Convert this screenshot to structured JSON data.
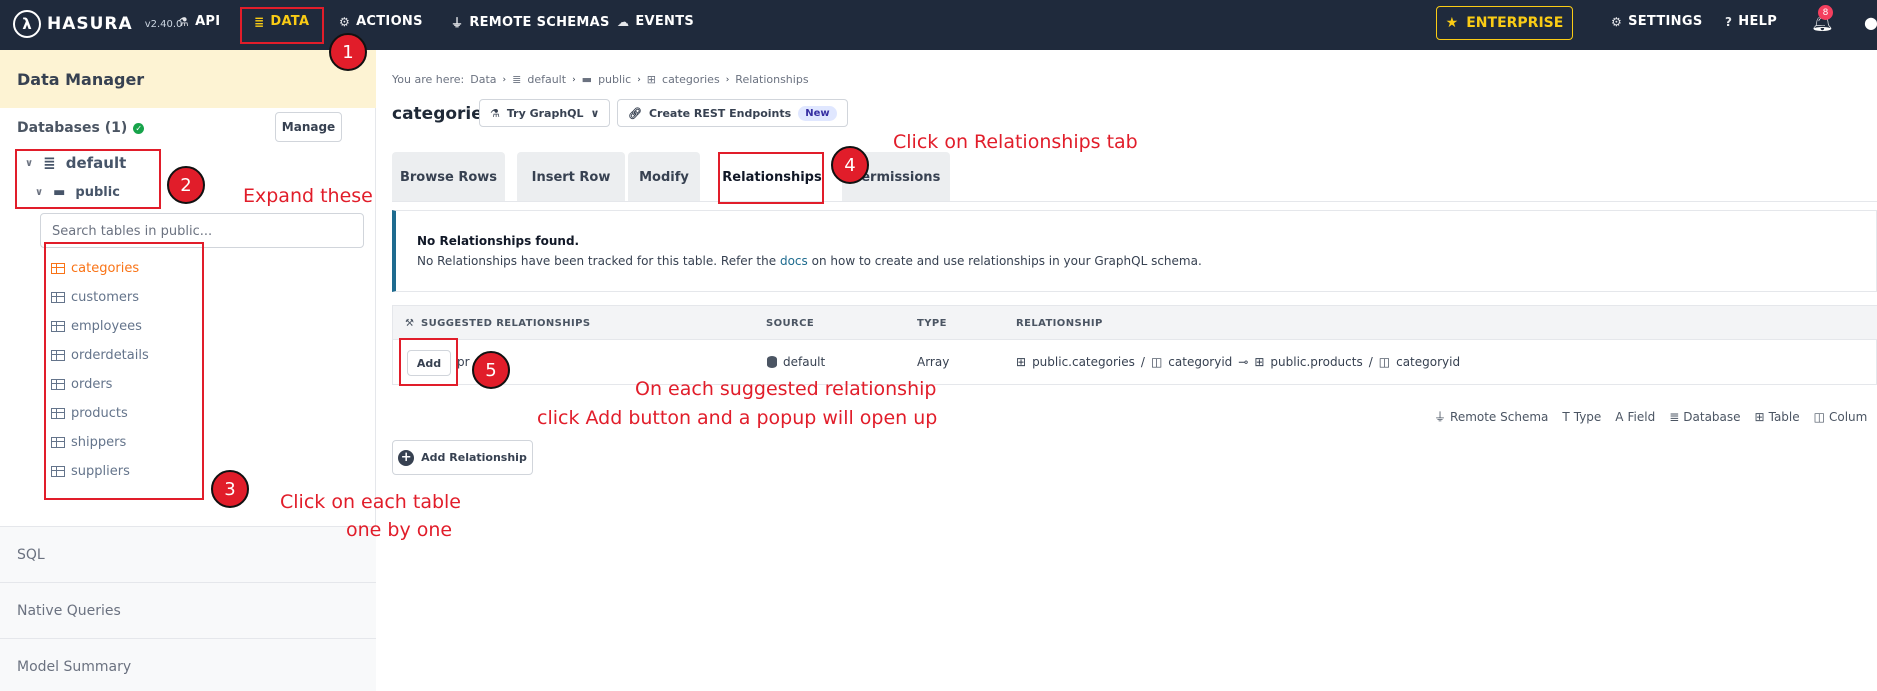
{
  "topbar": {
    "logo_text": "HASURA",
    "version": "v2.40.0",
    "nav": {
      "api": "API",
      "data": "DATA",
      "actions": "ACTIONS",
      "remote_schemas": "REMOTE SCHEMAS",
      "events": "EVENTS"
    },
    "enterprise": "ENTERPRISE",
    "settings": "SETTINGS",
    "help": "HELP",
    "notification_count": "8"
  },
  "sidebar": {
    "title": "Data Manager",
    "databases_label": "Databases (1)",
    "manage": "Manage",
    "database": "default",
    "schema": "public",
    "search_placeholder": "Search tables in public...",
    "tables": [
      "categories",
      "customers",
      "employees",
      "orderdetails",
      "orders",
      "products",
      "shippers",
      "suppliers"
    ],
    "sections": [
      "SQL",
      "Native Queries",
      "Model Summary"
    ]
  },
  "main": {
    "breadcrumb": {
      "prefix": "You are here:",
      "items": [
        "Data",
        "default",
        "public",
        "categories",
        "Relationships"
      ]
    },
    "title": "categories",
    "try_graphql": "Try GraphQL",
    "create_rest": "Create REST Endpoints",
    "new_badge": "New",
    "tabs": [
      "Browse Rows",
      "Insert Row",
      "Modify",
      "Relationships",
      "Permissions"
    ],
    "alert": {
      "title": "No Relationships found.",
      "body_before": "No Relationships have been tracked for this table. Refer the",
      "link": "docs",
      "body_after": "on how to create and use relationships in your GraphQL schema."
    },
    "suggested": {
      "headers": [
        "SUGGESTED RELATIONSHIPS",
        "SOURCE",
        "TYPE",
        "RELATIONSHIP"
      ],
      "row": {
        "add": "Add",
        "name": "pr",
        "source": "default",
        "type": "Array",
        "from_table": "public.categories",
        "from_col": "categoryid",
        "to_table": "public.products",
        "to_col": "categoryid",
        "slash": "/"
      }
    },
    "legend": [
      "Remote Schema",
      "Type",
      "Field",
      "Database",
      "Table",
      "Colum"
    ],
    "add_relationship": "Add Relationship"
  },
  "annotations": {
    "n1": "1",
    "n2": "2",
    "n3": "3",
    "n4": "4",
    "n5": "5",
    "expand": "Expand these",
    "click_tab": "Click on Relationships tab",
    "click_table_1": "Click on each table",
    "click_table_2": "one by one",
    "suggest_1": "On each suggested relationship",
    "suggest_2": "click Add button and a popup will open up"
  },
  "colors": {
    "topbar": "#1f2a3c",
    "accent_yellow": "#facc15",
    "active_table": "#f97316",
    "annotation_red": "#e11d2a",
    "alert_border": "#1e6b8f"
  }
}
